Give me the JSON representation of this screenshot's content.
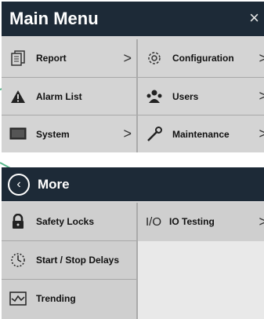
{
  "main_menu": {
    "title": "Main Menu",
    "close_glyph": "×",
    "items": [
      {
        "label": "Report",
        "icon": "report-icon",
        "has_chevron": true
      },
      {
        "label": "Configuration",
        "icon": "gear-icon",
        "has_chevron": true
      },
      {
        "label": "Alarm List",
        "icon": "warning-icon",
        "has_chevron": false
      },
      {
        "label": "Users",
        "icon": "users-icon",
        "has_chevron": true
      },
      {
        "label": "System",
        "icon": "monitor-icon",
        "has_chevron": true
      },
      {
        "label": "Maintenance",
        "icon": "wrench-icon",
        "has_chevron": true
      }
    ]
  },
  "more_menu": {
    "title": "More",
    "left_items": [
      {
        "label": "Safety Locks",
        "icon": "lock-icon"
      },
      {
        "label": "Start / Stop Delays",
        "icon": "timer-icon"
      },
      {
        "label": "Trending",
        "icon": "trend-icon"
      }
    ],
    "right_items": [
      {
        "prefix": "I/O",
        "label": "IO Testing",
        "icon": "io-icon",
        "has_chevron": true
      }
    ]
  },
  "chevron_glyph": ">",
  "colors": {
    "header": "#1d2a37",
    "panel": "#d4d4d4",
    "callout": "#58b58a"
  }
}
